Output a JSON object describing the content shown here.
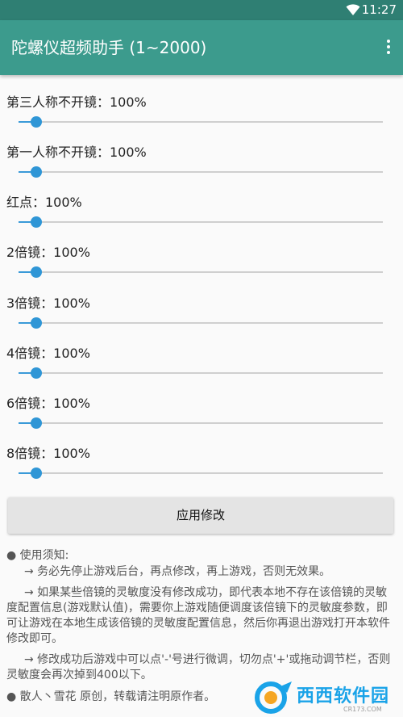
{
  "status_bar": {
    "time": "11:27",
    "wifi_icon": "wifi-icon"
  },
  "app_bar": {
    "title": "陀螺仪超频助手 (1~2000)",
    "menu_icon": "more-vert-icon"
  },
  "sliders": [
    {
      "label": "第三人称不开镜：100%",
      "fraction": 0.048
    },
    {
      "label": "第一人称不开镜：100%",
      "fraction": 0.048
    },
    {
      "label": "红点：100%",
      "fraction": 0.048
    },
    {
      "label": "2倍镜：100%",
      "fraction": 0.048
    },
    {
      "label": "3倍镜：100%",
      "fraction": 0.048
    },
    {
      "label": "4倍镜：100%",
      "fraction": 0.048
    },
    {
      "label": "6倍镜：100%",
      "fraction": 0.048
    },
    {
      "label": "8倍镜：100%",
      "fraction": 0.048
    }
  ],
  "apply_button": {
    "label": "应用修改"
  },
  "notes": {
    "heading": "● 使用须知:",
    "items": [
      "→ 务必先停止游戏后台，再点修改，再上游戏，否则无效果。",
      "→ 如果某些倍镜的灵敏度没有修改成功，即代表本地不存在该倍镜的灵敏度配置信息(游戏默认值)，需要你上游戏随便调度该倍镜下的灵敏度参数，即可让游戏在本地生成该倍镜的灵敏度配置信息，然后你再退出游戏打开本软件修改即可。",
      "→ 修改成功后游戏中可以点'-'号进行微调，切勿点'+'或拖动调节栏，否则灵敏度会再次掉到400以下。"
    ],
    "footer": "● 散人丶雪花 原创，转载请注明原作者。"
  },
  "watermark": {
    "text": "西西软件园",
    "sub": "CR173.COM"
  },
  "colors": {
    "status_bar": "#2f7f73",
    "app_bar": "#3c9b8d",
    "slider_accent": "#2f96d6",
    "background": "#fafafa"
  }
}
